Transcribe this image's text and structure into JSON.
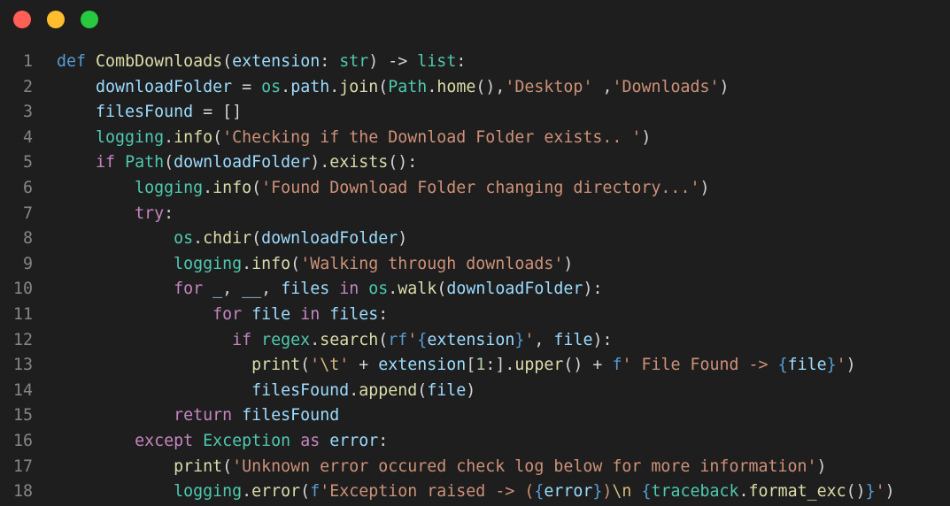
{
  "window": {
    "buttons": [
      {
        "name": "close",
        "color": "#ff5f56"
      },
      {
        "name": "minimize",
        "color": "#ffbd2e"
      },
      {
        "name": "zoom",
        "color": "#27c93f"
      }
    ]
  },
  "code": {
    "lines": [
      {
        "n": "1",
        "tokens": [
          [
            "kw",
            "def"
          ],
          [
            "pl",
            " "
          ],
          [
            "fn",
            "CombDownloads"
          ],
          [
            "pl",
            "("
          ],
          [
            "var",
            "extension"
          ],
          [
            "pl",
            ": "
          ],
          [
            "cls",
            "str"
          ],
          [
            "pl",
            ") -> "
          ],
          [
            "cls",
            "list"
          ],
          [
            "pl",
            ":"
          ]
        ]
      },
      {
        "n": "2",
        "tokens": [
          [
            "pl",
            "    "
          ],
          [
            "var",
            "downloadFolder"
          ],
          [
            "pl",
            " = "
          ],
          [
            "cls",
            "os"
          ],
          [
            "pl",
            "."
          ],
          [
            "var",
            "path"
          ],
          [
            "pl",
            "."
          ],
          [
            "fn",
            "join"
          ],
          [
            "pl",
            "("
          ],
          [
            "cls",
            "Path"
          ],
          [
            "pl",
            "."
          ],
          [
            "fn",
            "home"
          ],
          [
            "pl",
            "(),"
          ],
          [
            "str",
            "'Desktop'"
          ],
          [
            "pl",
            " ,"
          ],
          [
            "str",
            "'Downloads'"
          ],
          [
            "pl",
            ")"
          ]
        ]
      },
      {
        "n": "3",
        "tokens": [
          [
            "pl",
            "    "
          ],
          [
            "var",
            "filesFound"
          ],
          [
            "pl",
            " = []"
          ]
        ]
      },
      {
        "n": "4",
        "tokens": [
          [
            "pl",
            "    "
          ],
          [
            "cls",
            "logging"
          ],
          [
            "pl",
            "."
          ],
          [
            "fn",
            "info"
          ],
          [
            "pl",
            "("
          ],
          [
            "str",
            "'Checking if the Download Folder exists.. '"
          ],
          [
            "pl",
            ")"
          ]
        ]
      },
      {
        "n": "5",
        "tokens": [
          [
            "pl",
            "    "
          ],
          [
            "ctl",
            "if"
          ],
          [
            "pl",
            " "
          ],
          [
            "cls",
            "Path"
          ],
          [
            "pl",
            "("
          ],
          [
            "var",
            "downloadFolder"
          ],
          [
            "pl",
            ")."
          ],
          [
            "fn",
            "exists"
          ],
          [
            "pl",
            "():"
          ]
        ]
      },
      {
        "n": "6",
        "tokens": [
          [
            "pl",
            "        "
          ],
          [
            "cls",
            "logging"
          ],
          [
            "pl",
            "."
          ],
          [
            "fn",
            "info"
          ],
          [
            "pl",
            "("
          ],
          [
            "str",
            "'Found Download Folder changing directory...'"
          ],
          [
            "pl",
            ")"
          ]
        ]
      },
      {
        "n": "7",
        "tokens": [
          [
            "pl",
            "        "
          ],
          [
            "ctl",
            "try"
          ],
          [
            "pl",
            ":"
          ]
        ]
      },
      {
        "n": "8",
        "tokens": [
          [
            "pl",
            "            "
          ],
          [
            "cls",
            "os"
          ],
          [
            "pl",
            "."
          ],
          [
            "fn",
            "chdir"
          ],
          [
            "pl",
            "("
          ],
          [
            "var",
            "downloadFolder"
          ],
          [
            "pl",
            ")"
          ]
        ]
      },
      {
        "n": "9",
        "tokens": [
          [
            "pl",
            "            "
          ],
          [
            "cls",
            "logging"
          ],
          [
            "pl",
            "."
          ],
          [
            "fn",
            "info"
          ],
          [
            "pl",
            "("
          ],
          [
            "str",
            "'Walking through downloads'"
          ],
          [
            "pl",
            ")"
          ]
        ]
      },
      {
        "n": "10",
        "tokens": [
          [
            "pl",
            "            "
          ],
          [
            "ctl",
            "for"
          ],
          [
            "pl",
            " "
          ],
          [
            "var",
            "_"
          ],
          [
            "pl",
            ", "
          ],
          [
            "var",
            "__"
          ],
          [
            "pl",
            ", "
          ],
          [
            "var",
            "files"
          ],
          [
            "pl",
            " "
          ],
          [
            "ctl",
            "in"
          ],
          [
            "pl",
            " "
          ],
          [
            "cls",
            "os"
          ],
          [
            "pl",
            "."
          ],
          [
            "fn",
            "walk"
          ],
          [
            "pl",
            "("
          ],
          [
            "var",
            "downloadFolder"
          ],
          [
            "pl",
            "):"
          ]
        ]
      },
      {
        "n": "11",
        "tokens": [
          [
            "pl",
            "                "
          ],
          [
            "ctl",
            "for"
          ],
          [
            "pl",
            " "
          ],
          [
            "var",
            "file"
          ],
          [
            "pl",
            " "
          ],
          [
            "ctl",
            "in"
          ],
          [
            "pl",
            " "
          ],
          [
            "var",
            "files"
          ],
          [
            "pl",
            ":"
          ]
        ]
      },
      {
        "n": "12",
        "tokens": [
          [
            "pl",
            "                  "
          ],
          [
            "ctl",
            "if"
          ],
          [
            "pl",
            " "
          ],
          [
            "cls",
            "regex"
          ],
          [
            "pl",
            "."
          ],
          [
            "fn",
            "search"
          ],
          [
            "pl",
            "("
          ],
          [
            "kw",
            "rf"
          ],
          [
            "str",
            "'"
          ],
          [
            "kw",
            "{"
          ],
          [
            "var",
            "extension"
          ],
          [
            "kw",
            "}"
          ],
          [
            "str",
            "'"
          ],
          [
            "pl",
            ", "
          ],
          [
            "var",
            "file"
          ],
          [
            "pl",
            "):"
          ]
        ]
      },
      {
        "n": "13",
        "tokens": [
          [
            "pl",
            "                    "
          ],
          [
            "fn",
            "print"
          ],
          [
            "pl",
            "("
          ],
          [
            "str",
            "'"
          ],
          [
            "esc",
            "\\t"
          ],
          [
            "str",
            "'"
          ],
          [
            "pl",
            " + "
          ],
          [
            "var",
            "extension"
          ],
          [
            "pl",
            "["
          ],
          [
            "num",
            "1"
          ],
          [
            "pl",
            ":]."
          ],
          [
            "fn",
            "upper"
          ],
          [
            "pl",
            "() + "
          ],
          [
            "kw",
            "f"
          ],
          [
            "str",
            "' File Found -> "
          ],
          [
            "kw",
            "{"
          ],
          [
            "var",
            "file"
          ],
          [
            "kw",
            "}"
          ],
          [
            "str",
            "'"
          ],
          [
            "pl",
            ")"
          ]
        ]
      },
      {
        "n": "14",
        "tokens": [
          [
            "pl",
            "                    "
          ],
          [
            "var",
            "filesFound"
          ],
          [
            "pl",
            "."
          ],
          [
            "fn",
            "append"
          ],
          [
            "pl",
            "("
          ],
          [
            "var",
            "file"
          ],
          [
            "pl",
            ")"
          ]
        ]
      },
      {
        "n": "15",
        "tokens": [
          [
            "pl",
            "            "
          ],
          [
            "ctl",
            "return"
          ],
          [
            "pl",
            " "
          ],
          [
            "var",
            "filesFound"
          ]
        ]
      },
      {
        "n": "16",
        "tokens": [
          [
            "pl",
            "        "
          ],
          [
            "ctl",
            "except"
          ],
          [
            "pl",
            " "
          ],
          [
            "cls",
            "Exception"
          ],
          [
            "pl",
            " "
          ],
          [
            "ctl",
            "as"
          ],
          [
            "pl",
            " "
          ],
          [
            "var",
            "error"
          ],
          [
            "pl",
            ":"
          ]
        ]
      },
      {
        "n": "17",
        "tokens": [
          [
            "pl",
            "            "
          ],
          [
            "fn",
            "print"
          ],
          [
            "pl",
            "("
          ],
          [
            "str",
            "'Unknown error occured check log below for more information'"
          ],
          [
            "pl",
            ")"
          ]
        ]
      },
      {
        "n": "18",
        "tokens": [
          [
            "pl",
            "            "
          ],
          [
            "cls",
            "logging"
          ],
          [
            "pl",
            "."
          ],
          [
            "fn",
            "error"
          ],
          [
            "pl",
            "("
          ],
          [
            "kw",
            "f"
          ],
          [
            "str",
            "'Exception raised -> ("
          ],
          [
            "kw",
            "{"
          ],
          [
            "var",
            "error"
          ],
          [
            "kw",
            "}"
          ],
          [
            "str",
            ")"
          ],
          [
            "esc",
            "\\n"
          ],
          [
            "str",
            " "
          ],
          [
            "kw",
            "{"
          ],
          [
            "cls",
            "traceback"
          ],
          [
            "pl",
            "."
          ],
          [
            "fn",
            "format_exc"
          ],
          [
            "pl",
            "()"
          ],
          [
            "kw",
            "}"
          ],
          [
            "str",
            "'"
          ],
          [
            "pl",
            ")"
          ]
        ]
      }
    ]
  }
}
